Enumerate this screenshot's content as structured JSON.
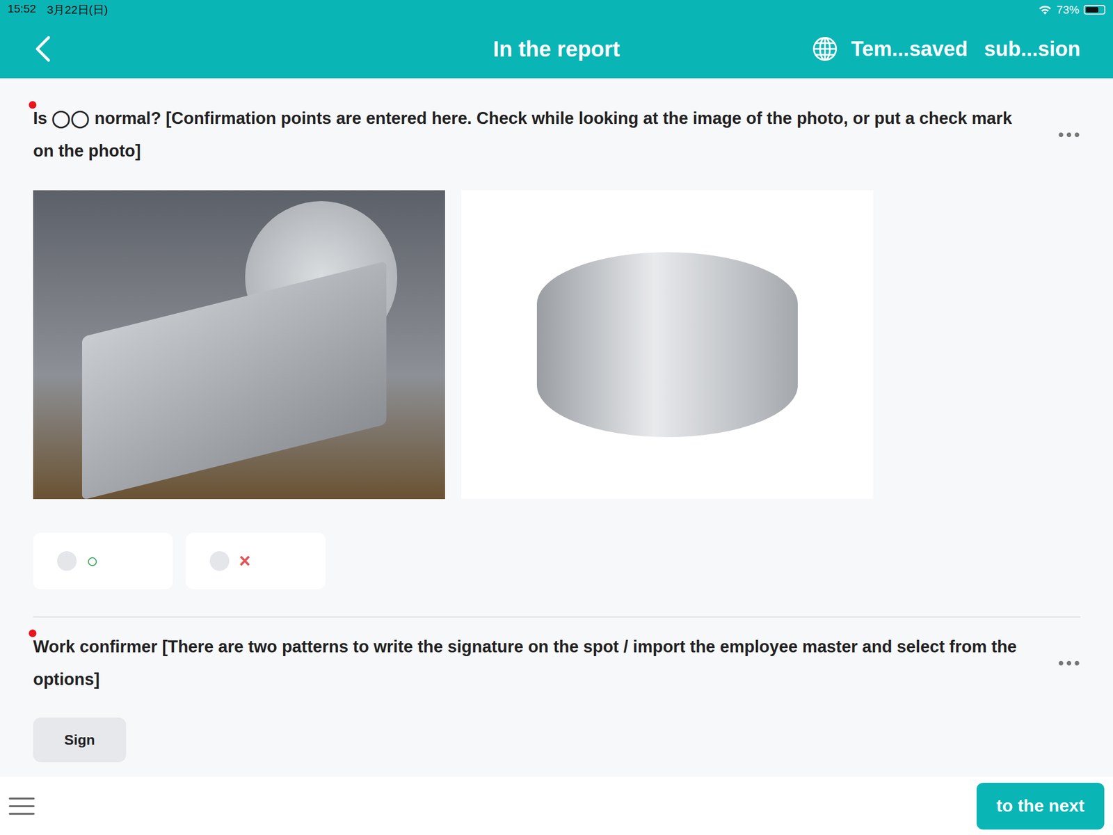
{
  "status_bar": {
    "time": "15:52",
    "date": "3月22日(日)",
    "battery": "73%",
    "battery_level": 0.73
  },
  "header": {
    "title": "In the report",
    "actions": [
      "Tem...saved",
      "sub...sion"
    ]
  },
  "questions": [
    {
      "kind": "choice",
      "required": true,
      "text": "Is ◯◯ normal? [Confirmation points are entered here. Check while looking at the image of the photo, or put a check mark on the photo]",
      "photos": [
        {
          "kind": "dark"
        },
        {
          "kind": "light"
        }
      ],
      "options": [
        {
          "label": "○",
          "selected": false,
          "color": "#1a9e4b"
        },
        {
          "label": "×",
          "selected": false,
          "color": "#e05555"
        }
      ]
    },
    {
      "kind": "signature",
      "required": true,
      "text": "Work confirmer [There are two patterns to write the signature on the spot / import the employee master and select from the options]",
      "button": "Sign"
    }
  ],
  "footer": {
    "next": "to the next"
  }
}
